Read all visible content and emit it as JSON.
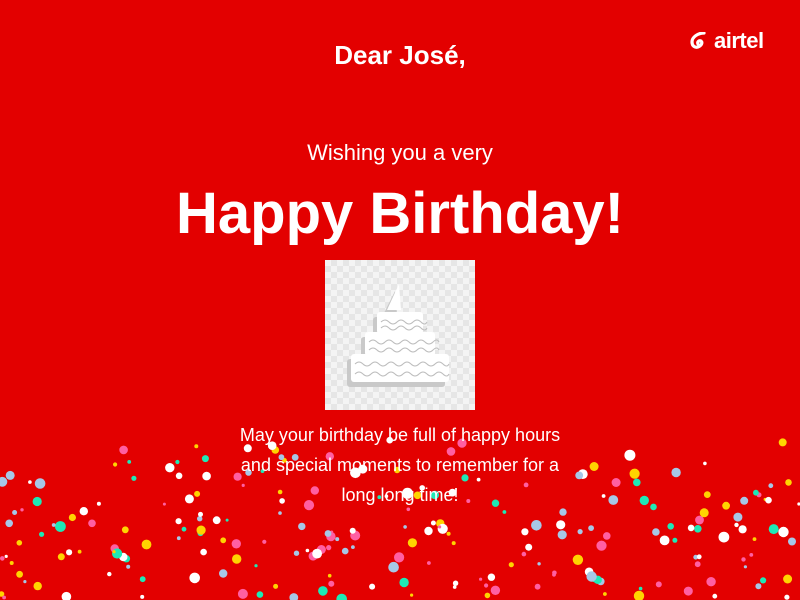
{
  "brand": {
    "name": "airtel",
    "logo_icon": "airtel-swoosh-icon",
    "primary_color": "#e30000",
    "text_color": "#ffffff"
  },
  "card": {
    "greeting": "Dear José,",
    "wish_prefix": "Wishing you a very",
    "headline": "Happy Birthday!",
    "cake_icon": "birthday-cake-icon",
    "message_lines": [
      "May your birthday be full of happy hours",
      "and special moments to remember for a",
      "long long time!"
    ]
  },
  "decoration": {
    "confetti_colors": [
      "#ffffff",
      "#ffd400",
      "#1de9b6",
      "#ff5fa2",
      "#a7c7e7"
    ]
  }
}
